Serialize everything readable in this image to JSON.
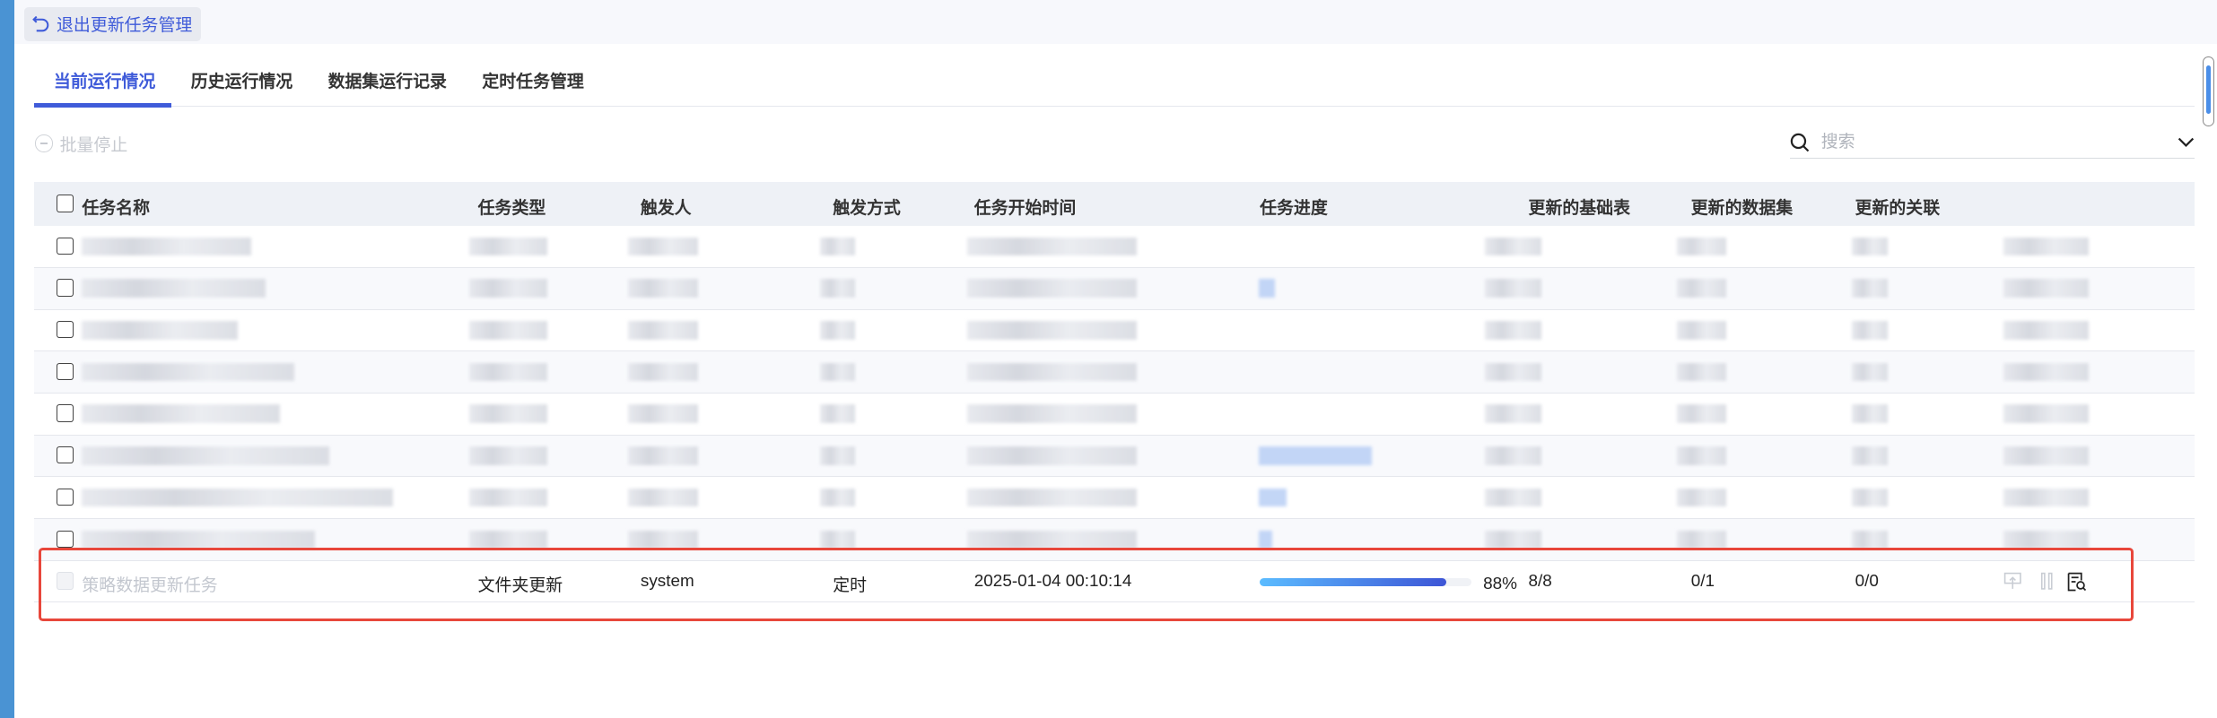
{
  "header": {
    "back_label": "退出更新任务管理"
  },
  "tabs": [
    {
      "label": "当前运行情况",
      "active": true
    },
    {
      "label": "历史运行情况"
    },
    {
      "label": "数据集运行记录"
    },
    {
      "label": "定时任务管理"
    }
  ],
  "toolbar": {
    "batch_stop_label": "批量停止",
    "search_placeholder": "搜索"
  },
  "table": {
    "columns": [
      "任务名称",
      "任务类型",
      "触发人",
      "触发方式",
      "任务开始时间",
      "任务进度",
      "更新的基础表",
      "更新的数据集",
      "更新的关联"
    ],
    "highlighted_row": {
      "name": "策略数据更新任务",
      "type": "文件夹更新",
      "trigger_user": "system",
      "trigger_method": "定时",
      "start_time": "2025-01-04 00:10:14",
      "progress": 88,
      "progress_label": "88%",
      "base_tables": "8/8",
      "datasets": "0/1",
      "relations": "0/0"
    }
  },
  "colors": {
    "accent": "#3f5bd9",
    "highlight_border": "#e8473b"
  }
}
